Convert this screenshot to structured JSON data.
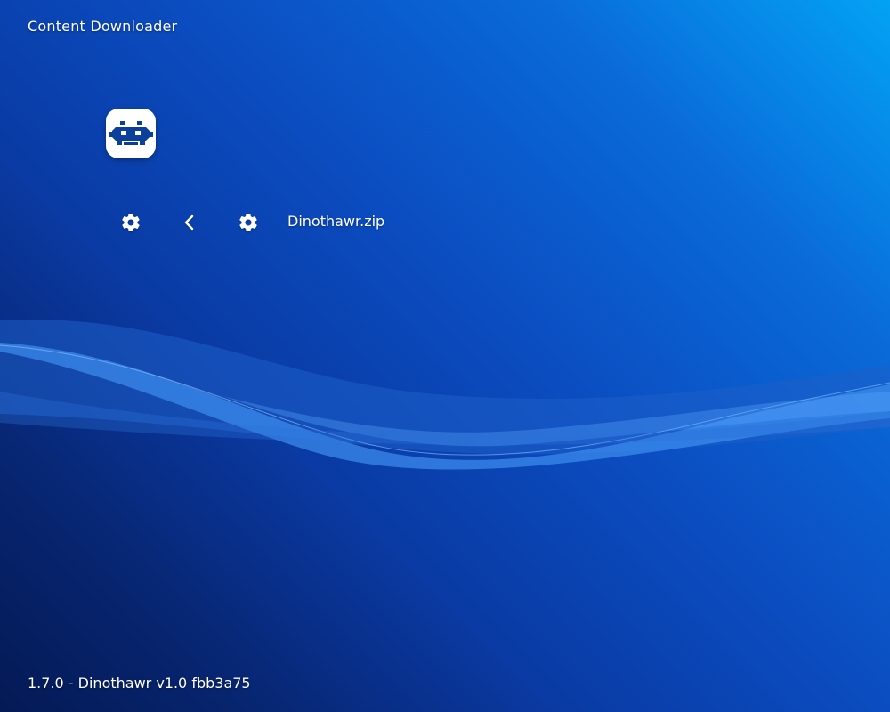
{
  "header": {
    "title": "Content Downloader"
  },
  "app_tile": {
    "icon": "retroarch-invader-icon"
  },
  "entry_row": {
    "left_icon": "gear-icon",
    "back_icon": "chevron-left-icon",
    "item_icon": "gear-icon",
    "label": "Dinothawr.zip"
  },
  "footer": {
    "version_text": "1.7.0 - Dinothawr v1.0 fbb3a75"
  },
  "colors": {
    "background_top_right": "#03a2f5",
    "background_bottom_left": "#041a55",
    "wave_light": "#3d8ff0",
    "text": "#ffffff",
    "icon_blue": "#0a3f9c"
  }
}
